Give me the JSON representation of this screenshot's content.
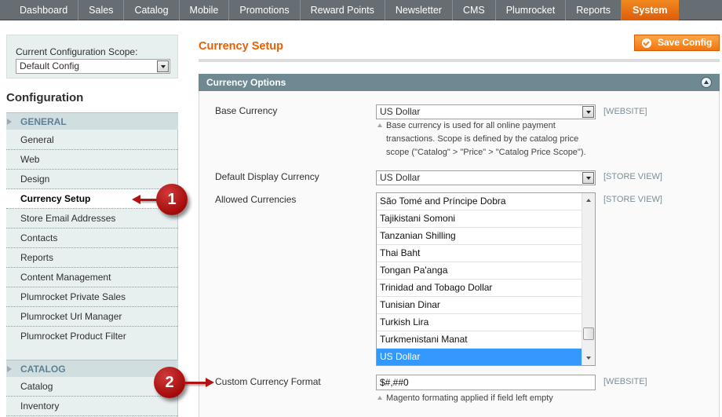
{
  "nav": {
    "items": [
      {
        "label": "Dashboard"
      },
      {
        "label": "Sales"
      },
      {
        "label": "Catalog"
      },
      {
        "label": "Mobile"
      },
      {
        "label": "Promotions"
      },
      {
        "label": "Reward Points"
      },
      {
        "label": "Newsletter"
      },
      {
        "label": "CMS"
      },
      {
        "label": "Plumrocket"
      },
      {
        "label": "Reports"
      },
      {
        "label": "System"
      }
    ],
    "active": "System"
  },
  "sidebar": {
    "scope_label": "Current Configuration Scope:",
    "scope_value": "Default Config",
    "title": "Configuration",
    "sections": [
      {
        "heading": "GENERAL",
        "items": [
          {
            "label": "General"
          },
          {
            "label": "Web"
          },
          {
            "label": "Design"
          },
          {
            "label": "Currency Setup",
            "active": true
          },
          {
            "label": "Store Email Addresses"
          },
          {
            "label": "Contacts"
          },
          {
            "label": "Reports"
          },
          {
            "label": "Content Management"
          },
          {
            "label": "Plumrocket Private Sales"
          },
          {
            "label": "Plumrocket Url Manager"
          },
          {
            "label": "Plumrocket Product Filter"
          }
        ]
      },
      {
        "heading": "CATALOG",
        "items": [
          {
            "label": "Catalog"
          },
          {
            "label": "Inventory"
          }
        ]
      }
    ]
  },
  "main": {
    "title": "Currency Setup",
    "save_label": "Save Config",
    "panel_title": "Currency Options",
    "fields": {
      "base_currency": {
        "label": "Base Currency",
        "value": "US Dollar",
        "scope": "[WEBSITE]",
        "note_lines": [
          "Base currency is used for all online payment",
          "transactions. Scope is defined by the catalog price",
          "scope (\"Catalog\" > \"Price\" > \"Catalog Price Scope\")."
        ]
      },
      "default_display_currency": {
        "label": "Default Display Currency",
        "value": "US Dollar",
        "scope": "[STORE VIEW]"
      },
      "allowed_currencies": {
        "label": "Allowed Currencies",
        "scope": "[STORE VIEW]",
        "options": [
          "São Tomé and Príncipe Dobra",
          "Tajikistani Somoni",
          "Tanzanian Shilling",
          "Thai Baht",
          "Tongan Pa'anga",
          "Trinidad and Tobago Dollar",
          "Tunisian Dinar",
          "Turkish Lira",
          "Turkmenistani Manat",
          "US Dollar"
        ],
        "selected": "US Dollar"
      },
      "custom_currency_format": {
        "label": "Custom Currency Format",
        "value": "$#,##0",
        "scope": "[WEBSITE]",
        "note": "Magento formating applied if field left empty"
      }
    }
  },
  "callouts": {
    "first": "1",
    "second": "2"
  },
  "colors": {
    "accent": "#eb5e00",
    "nav_bg": "#666e73",
    "panel_head": "#6f8992",
    "selection": "#3399ff",
    "callout": "#b31212"
  }
}
